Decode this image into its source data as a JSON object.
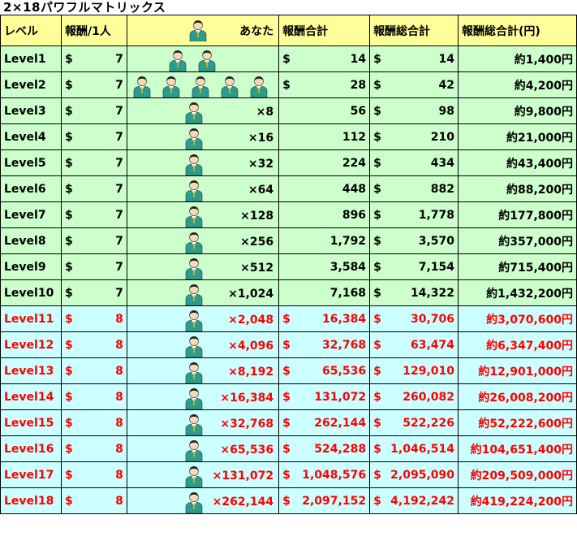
{
  "title": "2×18パワフルマトリックス",
  "headers": {
    "level": "レベル",
    "rate": "報酬/1人",
    "you": "あなた",
    "sum": "報酬合計",
    "total": "報酬総合計",
    "yen": "報酬総合計(円)"
  },
  "colors": {
    "green_bg": "#ccffcc",
    "cyan_bg": "#ccffff",
    "header_bg": "#ffff99",
    "red_text": "#ff0000"
  },
  "icon": "businessman-icon",
  "rows": [
    {
      "level": "Level1",
      "cur": "$",
      "rate": "7",
      "mult": "",
      "sum_cur": "$",
      "sum": "14",
      "total": "14",
      "yen": "約1,400円",
      "people": 2
    },
    {
      "level": "Level2",
      "cur": "$",
      "rate": "7",
      "mult": "",
      "sum_cur": "$",
      "sum": "28",
      "total": "42",
      "yen": "約4,200円",
      "people": 5
    },
    {
      "level": "Level3",
      "cur": "$",
      "rate": "7",
      "mult": "×8",
      "sum_cur": "",
      "sum": "56",
      "total": "98",
      "yen": "約9,800円",
      "people": 1
    },
    {
      "level": "Level4",
      "cur": "$",
      "rate": "7",
      "mult": "×16",
      "sum_cur": "",
      "sum": "112",
      "total": "210",
      "yen": "約21,000円",
      "people": 1
    },
    {
      "level": "Level5",
      "cur": "$",
      "rate": "7",
      "mult": "×32",
      "sum_cur": "",
      "sum": "224",
      "total": "434",
      "yen": "約43,400円",
      "people": 1
    },
    {
      "level": "Level6",
      "cur": "$",
      "rate": "7",
      "mult": "×64",
      "sum_cur": "",
      "sum": "448",
      "total": "882",
      "yen": "約88,200円",
      "people": 1
    },
    {
      "level": "Level7",
      "cur": "$",
      "rate": "7",
      "mult": "×128",
      "sum_cur": "",
      "sum": "896",
      "total": "1,778",
      "yen": "約177,800円",
      "people": 1
    },
    {
      "level": "Level8",
      "cur": "$",
      "rate": "7",
      "mult": "×256",
      "sum_cur": "",
      "sum": "1,792",
      "total": "3,570",
      "yen": "約357,000円",
      "people": 1
    },
    {
      "level": "Level9",
      "cur": "$",
      "rate": "7",
      "mult": "×512",
      "sum_cur": "",
      "sum": "3,584",
      "total": "7,154",
      "yen": "約715,400円",
      "people": 1
    },
    {
      "level": "Level10",
      "cur": "$",
      "rate": "7",
      "mult": "×1,024",
      "sum_cur": "",
      "sum": "7,168",
      "total": "14,322",
      "yen": "約1,432,200円",
      "people": 1
    },
    {
      "level": "Level11",
      "cur": "$",
      "rate": "8",
      "mult": "×2,048",
      "sum_cur": "$",
      "sum": "16,384",
      "total": "30,706",
      "yen": "約3,070,600円",
      "people": 1
    },
    {
      "level": "Level12",
      "cur": "$",
      "rate": "8",
      "mult": "×4,096",
      "sum_cur": "$",
      "sum": "32,768",
      "total": "63,474",
      "yen": "約6,347,400円",
      "people": 1
    },
    {
      "level": "Level13",
      "cur": "$",
      "rate": "8",
      "mult": "×8,192",
      "sum_cur": "$",
      "sum": "65,536",
      "total": "129,010",
      "yen": "約12,901,000円",
      "people": 1
    },
    {
      "level": "Level14",
      "cur": "$",
      "rate": "8",
      "mult": "×16,384",
      "sum_cur": "$",
      "sum": "131,072",
      "total": "260,082",
      "yen": "約26,008,200円",
      "people": 1
    },
    {
      "level": "Level15",
      "cur": "$",
      "rate": "8",
      "mult": "×32,768",
      "sum_cur": "$",
      "sum": "262,144",
      "total": "522,226",
      "yen": "約52,222,600円",
      "people": 1
    },
    {
      "level": "Level16",
      "cur": "$",
      "rate": "8",
      "mult": "×65,536",
      "sum_cur": "$",
      "sum": "524,288",
      "total": "1,046,514",
      "yen": "約104,651,400円",
      "people": 1
    },
    {
      "level": "Level17",
      "cur": "$",
      "rate": "8",
      "mult": "×131,072",
      "sum_cur": "$",
      "sum": "1,048,576",
      "total": "2,095,090",
      "yen": "約209,509,000円",
      "people": 1
    },
    {
      "level": "Level18",
      "cur": "$",
      "rate": "8",
      "mult": "×262,144",
      "sum_cur": "$",
      "sum": "2,097,152",
      "total": "4,192,242",
      "yen": "約419,224,200円",
      "people": 1
    }
  ]
}
